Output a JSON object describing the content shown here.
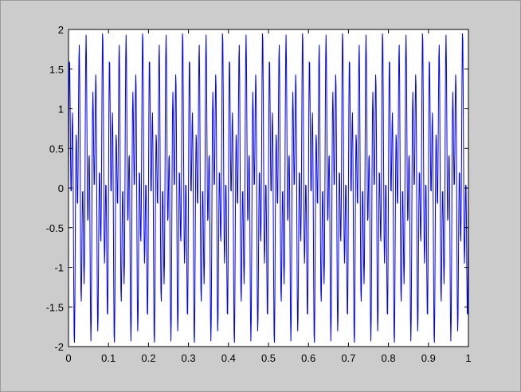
{
  "chart_data": {
    "type": "line",
    "title": "",
    "xlabel": "",
    "ylabel": "",
    "xlim": [
      0,
      1
    ],
    "ylim": [
      -2,
      2
    ],
    "x_ticks": [
      0,
      0.1,
      0.2,
      0.3,
      0.4,
      0.5,
      0.6,
      0.7,
      0.8,
      0.9,
      1
    ],
    "x_tick_labels": [
      "0",
      "0.1",
      "0.2",
      "0.3",
      "0.4",
      "0.5",
      "0.6",
      "0.7",
      "0.8",
      "0.9",
      "1"
    ],
    "y_ticks": [
      2,
      1.5,
      1,
      0.5,
      0,
      -0.5,
      -1,
      -1.5,
      -2
    ],
    "y_tick_labels": [
      "2",
      "1.5",
      "1",
      "0.5",
      "0",
      "-0.5",
      "-1",
      "-1.5",
      "-2"
    ],
    "grid": false,
    "series": [
      {
        "color": "#0000ff",
        "signal": {
          "form": "sum of two sines",
          "components": [
            {
              "amplitude": 1,
              "frequency_hz": 50
            },
            {
              "amplitude": 1,
              "frequency_hz": 120
            }
          ],
          "sample_rate_hz": 1000,
          "t_start": 0,
          "t_end": 1
        }
      }
    ]
  },
  "colors": {
    "figure_background": "#cccccc",
    "axes_background": "#ffffff",
    "line": "#0000ff",
    "axes_frame": "#000000"
  }
}
